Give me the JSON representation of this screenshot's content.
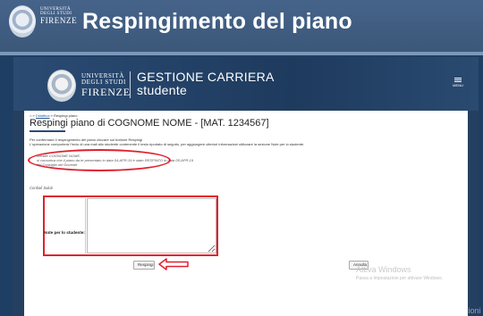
{
  "banner": {
    "university_line1": "UNIVERSITÀ",
    "university_line2": "DEGLI STUDI",
    "university_line3": "FIRENZE",
    "title": "Respingimento del piano"
  },
  "app": {
    "university_line1": "UNIVERSITÀ",
    "university_line2": "DEGLI STUDI",
    "university_line3": "FIRENZE",
    "title_line1": "GESTIONE CARRIERA",
    "title_line2": "studente",
    "menu_label": "MENU"
  },
  "breadcrumb": {
    "home_icon": "home-icon",
    "link": "Didattica",
    "separator": "»",
    "current": "Respingi piano"
  },
  "page": {
    "title": "Respingi piano di COGNOME NOME - [MAT. 1234567]",
    "intro_line1": "Per confermare il respingimento del piano cliccare sul bottone Respingi",
    "intro_line2": "L'operazione comporterà l'invio di una mail allo studente contenente il testo riportato di seguito, per aggiungere ulteriori informazioni utilizzare la sezione Note per lo studente."
  },
  "message": {
    "greeting": "Gentile COGNOME NOME,",
    "body": "si comunica che il piano da te presentato in data 04-APR-19 è stato RESPINTO in data 05-APR-19",
    "body2": "dal Consiglio del Docente",
    "closing": "Cordiali Saluti"
  },
  "note": {
    "label": "Note per lo studente:",
    "value": ""
  },
  "buttons": {
    "respingi": "Respingi",
    "annulla": "Annulla"
  },
  "watermarks": {
    "inner_title": "Attiva Windows",
    "inner_sub": "Passa a Impostazioni per attivare Windows.",
    "outer_title": "Attiva Windows",
    "outer_sub": "Passa a Impostazioni"
  },
  "colors": {
    "highlight": "#e0202e",
    "header": "#1e3b5e"
  }
}
